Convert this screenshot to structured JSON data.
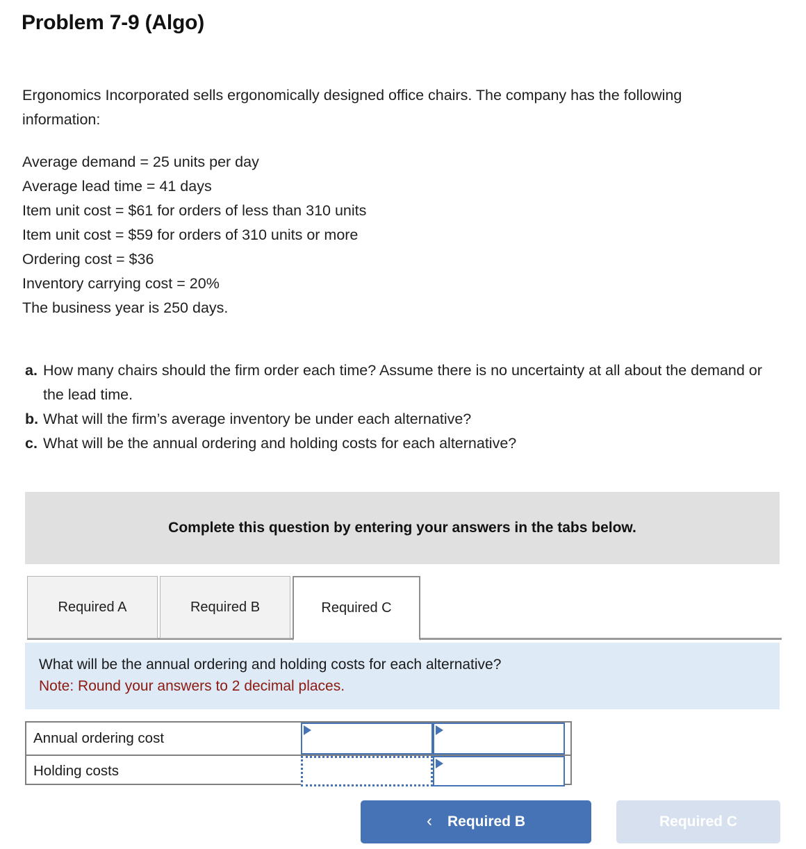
{
  "problem": {
    "title": "Problem 7-9 (Algo)",
    "intro": "Ergonomics Incorporated sells ergonomically designed office chairs. The company has the following information:",
    "facts": [
      "Average demand = 25 units per day",
      "Average lead time = 41 days",
      "Item unit cost = $61 for orders of less than 310 units",
      "Item unit cost = $59 for orders of 310 units or more",
      "Ordering cost = $36",
      "Inventory carrying cost = 20%",
      "The business year is 250 days."
    ],
    "requirements": [
      {
        "letter": "a.",
        "text": "How many chairs should the firm order each time? Assume there is no uncertainty at all about the demand or the lead time."
      },
      {
        "letter": "b.",
        "text": "What will the firm’s average inventory be under each alternative?"
      },
      {
        "letter": "c.",
        "text": "What will be the annual ordering and holding costs for each alternative?"
      }
    ]
  },
  "banner": {
    "text": "Complete this question by entering your answers in the tabs below."
  },
  "tabs": [
    {
      "label": "Required A",
      "active": false
    },
    {
      "label": "Required B",
      "active": false
    },
    {
      "label": "Required C",
      "active": true
    }
  ],
  "panel": {
    "question": "What will be the annual ordering and holding costs for each alternative?",
    "note": "Note: Round your answers to 2 decimal places."
  },
  "answer_table": {
    "rows": [
      {
        "label": "Annual ordering cost",
        "cells": [
          {
            "value": "",
            "placeholder": "",
            "state": "solid"
          },
          {
            "value": "",
            "placeholder": "",
            "state": "solid"
          }
        ]
      },
      {
        "label": "Holding costs",
        "cells": [
          {
            "value": "",
            "placeholder": "",
            "state": "dotted"
          },
          {
            "value": "",
            "placeholder": "",
            "state": "solid"
          }
        ]
      }
    ]
  },
  "nav": {
    "prev_label": "Required B",
    "prev_icon": "chevron-left-icon",
    "next_label": "Required C"
  },
  "colors": {
    "accent_blue": "#4573b5",
    "disabled_blue": "#d6e0ee",
    "panel_blue": "#deeaf6",
    "banner_gray": "#e0e0e0",
    "note_red": "#8c1a10",
    "tab_inactive": "#f2f2f2",
    "table_border_gray": "#808080"
  }
}
